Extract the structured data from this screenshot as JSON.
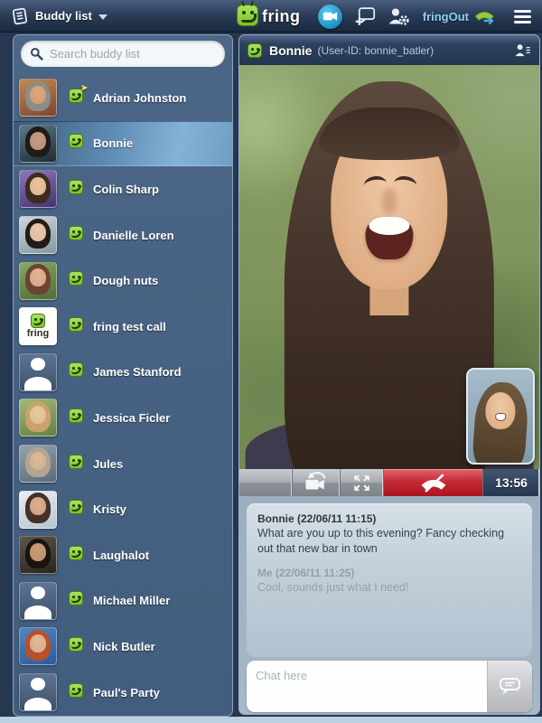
{
  "top_bar": {
    "buddy_list_label": "Buddy list",
    "brand": "fring",
    "fringout_label": "fringOut",
    "icons": [
      "buddy-list-icon",
      "video-call-icon",
      "add-chat-icon",
      "contacts-settings-icon",
      "fringout-phone-icon",
      "menu-icon"
    ]
  },
  "sidebar": {
    "search_placeholder": "Search buddy list",
    "buddies": [
      {
        "name": "Adrian Johnston",
        "away": true,
        "avatar": {
          "type": "photo",
          "bg1": "#c28b52",
          "bg2": "#7a4632",
          "hair": "#8d8d86",
          "skin": "#dca87c"
        }
      },
      {
        "name": "Bonnie",
        "selected": true,
        "avatar": {
          "type": "photo",
          "bg1": "#5d7a86",
          "bg2": "#1e2b33",
          "hair": "#1f1b19",
          "skin": "#c79a82"
        }
      },
      {
        "name": "Colin Sharp",
        "avatar": {
          "type": "photo",
          "bg1": "#8a7ab8",
          "bg2": "#44336e",
          "hair": "#3c2b20",
          "skin": "#ecc49c"
        }
      },
      {
        "name": "Danielle Loren",
        "avatar": {
          "type": "photo",
          "bg1": "#cdd6da",
          "bg2": "#87989f",
          "hair": "#221c19",
          "skin": "#ecc8aa"
        }
      },
      {
        "name": "Dough nuts",
        "avatar": {
          "type": "photo",
          "bg1": "#86a864",
          "bg2": "#4e6c3a",
          "hair": "#6e4430",
          "skin": "#e4b492"
        }
      },
      {
        "name": "fring test call",
        "avatar": {
          "type": "logo",
          "text": "fring"
        }
      },
      {
        "name": "James Stanford",
        "avatar": {
          "type": "silhouette"
        }
      },
      {
        "name": "Jessica Ficler",
        "avatar": {
          "type": "photo",
          "bg1": "#a2b878",
          "bg2": "#657f46",
          "hair": "#c8a468",
          "skin": "#ecca9e"
        }
      },
      {
        "name": "Jules",
        "avatar": {
          "type": "photo",
          "bg1": "#93a3b0",
          "bg2": "#5a6a78",
          "hair": "#b4a38e",
          "skin": "#dcbc9a"
        }
      },
      {
        "name": "Kristy",
        "avatar": {
          "type": "photo",
          "bg1": "#eceff2",
          "bg2": "#b4c4d0",
          "hair": "#46302a",
          "skin": "#dcae8c"
        }
      },
      {
        "name": "Laughalot",
        "avatar": {
          "type": "photo",
          "bg1": "#5d554a",
          "bg2": "#272420",
          "hair": "#19140f",
          "skin": "#c89c78"
        }
      },
      {
        "name": "Michael Miller",
        "avatar": {
          "type": "silhouette"
        }
      },
      {
        "name": "Nick Butler",
        "avatar": {
          "type": "photo",
          "bg1": "#5584bc",
          "bg2": "#2c5c9c",
          "hair": "#b8502c",
          "skin": "#e6b896"
        }
      },
      {
        "name": "Paul's Party",
        "avatar": {
          "type": "silhouette"
        }
      }
    ]
  },
  "call": {
    "title_name": "Bonnie",
    "title_userid": "(User-ID: bonnie_batler)",
    "timer": "13:56",
    "controls": [
      "switch-camera-icon",
      "fullscreen-icon",
      "hangup-icon"
    ]
  },
  "chat": {
    "messages": [
      {
        "sender": "Bonnie",
        "timestamp": "(22/06/11 11:15)",
        "text": "What are you up to this evening? Fancy checking out that new bar in town",
        "own": false
      },
      {
        "sender": "Me",
        "timestamp": "(22/06/11 11:25)",
        "text": "Cool, sounds just what I need!",
        "own": true
      }
    ],
    "input_placeholder": "Chat here"
  },
  "colors": {
    "status_green": "#8ed33f",
    "hangup_red": "#c62b35",
    "video_call_blue": "#2aa9dd",
    "fringout_text": "#8fd0f8",
    "selected_row": "#83b2d9"
  }
}
